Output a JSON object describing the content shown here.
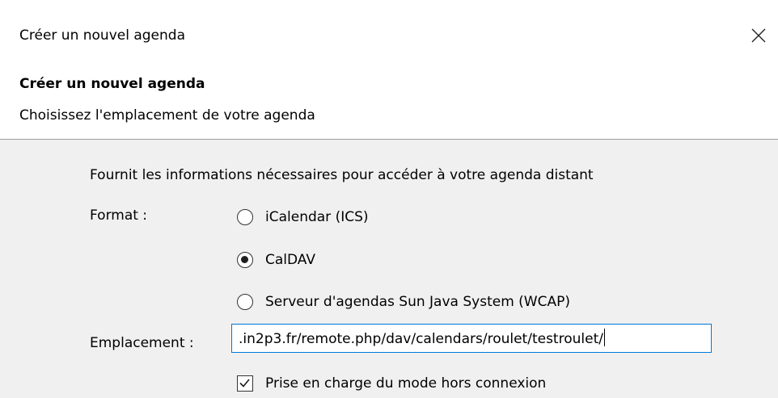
{
  "window": {
    "title": "Créer un nouvel agenda"
  },
  "header": {
    "title": "Créer un nouvel agenda",
    "subtitle": "Choisissez l'emplacement de votre agenda"
  },
  "form": {
    "description": "Fournit les informations nécessaires pour accéder à votre agenda distant",
    "format_label": "Format :",
    "formats": [
      {
        "label": "iCalendar (ICS)",
        "checked": false
      },
      {
        "label": "CalDAV",
        "checked": true
      },
      {
        "label": "Serveur d'agendas Sun Java System (WCAP)",
        "checked": false
      }
    ],
    "location_label": "Emplacement :",
    "location_value": ".in2p3.fr/remote.php/dav/calendars/roulet/testroulet/",
    "offline_label": "Prise en charge du mode hors connexion",
    "offline_checked": true
  },
  "icons": {
    "close": "close-icon",
    "radio": "radio-icon",
    "checkbox": "checkmark-icon"
  },
  "colors": {
    "focus_border": "#0078d7",
    "content_background": "#f0f0f0"
  }
}
